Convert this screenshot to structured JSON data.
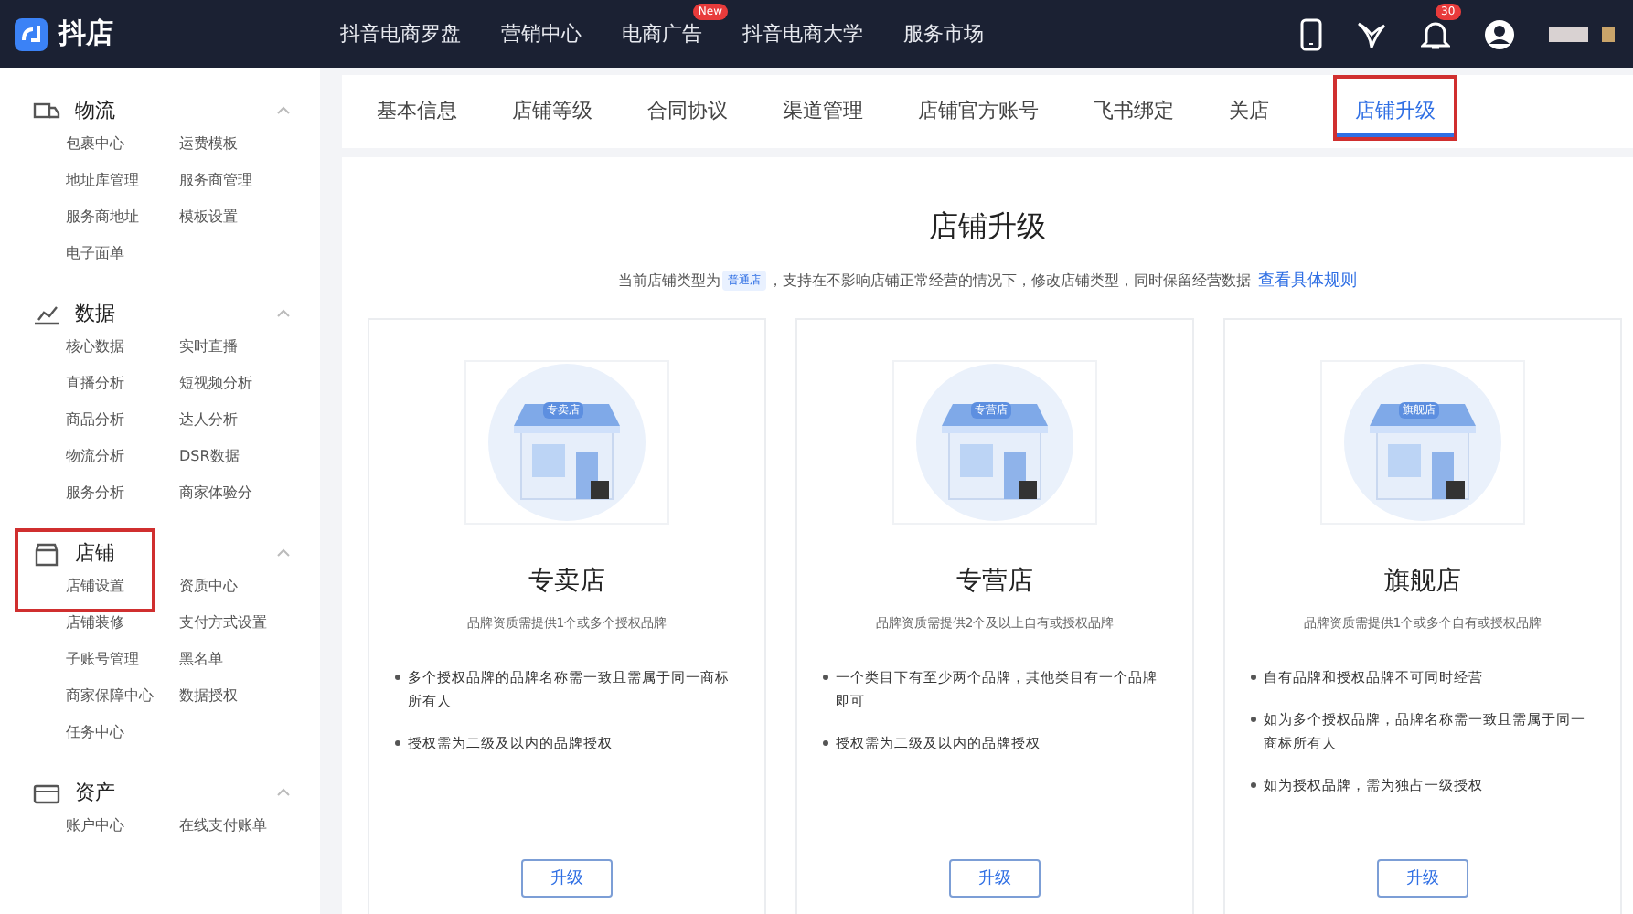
{
  "topbar": {
    "logo": "抖店",
    "nav": [
      {
        "label": "抖音电商罗盘"
      },
      {
        "label": "营销中心"
      },
      {
        "label": "电商广告",
        "badge": "New"
      },
      {
        "label": "抖音电商大学"
      },
      {
        "label": "服务市场"
      }
    ],
    "notification_badge": "30"
  },
  "sidebar": {
    "sections": [
      {
        "title": "物流",
        "highlighted": false,
        "items": [
          "包裹中心",
          "运费模板",
          "地址库管理",
          "服务商管理",
          "服务商地址",
          "模板设置",
          "电子面单"
        ]
      },
      {
        "title": "数据",
        "highlighted": false,
        "items": [
          "核心数据",
          "实时直播",
          "直播分析",
          "短视频分析",
          "商品分析",
          "达人分析",
          "物流分析",
          "DSR数据",
          "服务分析",
          "商家体验分"
        ]
      },
      {
        "title": "店铺",
        "highlighted": true,
        "items": [
          "店铺设置",
          "资质中心",
          "店铺装修",
          "支付方式设置",
          "子账号管理",
          "黑名单",
          "商家保障中心",
          "数据授权",
          "任务中心"
        ]
      },
      {
        "title": "资产",
        "highlighted": false,
        "items": [
          "账户中心",
          "在线支付账单"
        ]
      }
    ]
  },
  "tabs": [
    {
      "label": "基本信息",
      "selected": false
    },
    {
      "label": "店铺等级",
      "selected": false
    },
    {
      "label": "合同协议",
      "selected": false
    },
    {
      "label": "渠道管理",
      "selected": false
    },
    {
      "label": "店铺官方账号",
      "selected": false
    },
    {
      "label": "飞书绑定",
      "selected": false
    },
    {
      "label": "关店",
      "selected": false
    },
    {
      "label": "店铺升级",
      "selected": true
    }
  ],
  "page": {
    "title": "店铺升级",
    "intro_before": "当前店铺类型为",
    "store_type": "普通店",
    "intro_after": "，支持在不影响店铺正常经营的情况下，修改店铺类型，同时保留经营数据",
    "rules_link": "查看具体规则"
  },
  "cards": [
    {
      "name": "专卖店",
      "subtitle": "品牌资质需提供1个或多个授权品牌",
      "sign": "专卖店",
      "rules": [
        "多个授权品牌的品牌名称需一致且需属于同一商标所有人",
        "授权需为二级及以内的品牌授权"
      ],
      "button": "升级"
    },
    {
      "name": "专营店",
      "subtitle": "品牌资质需提供2个及以上自有或授权品牌",
      "sign": "专营店",
      "rules": [
        "一个类目下有至少两个品牌，其他类目有一个品牌即可",
        "授权需为二级及以内的品牌授权"
      ],
      "button": "升级"
    },
    {
      "name": "旗舰店",
      "subtitle": "品牌资质需提供1个或多个自有或授权品牌",
      "sign": "旗舰店",
      "rules": [
        "自有品牌和授权品牌不可同时经营",
        "如为多个授权品牌，品牌名称需一致且需属于同一商标所有人",
        "如为授权品牌，需为独占一级授权"
      ],
      "button": "升级"
    }
  ]
}
